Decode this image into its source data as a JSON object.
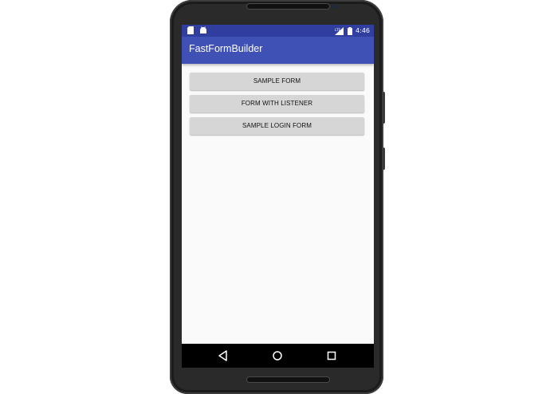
{
  "status_bar": {
    "time": "4:46",
    "network": "LTE",
    "left_icons": [
      "sd-card-icon",
      "android-icon"
    ],
    "right_icons": [
      "signal-icon",
      "battery-icon"
    ],
    "color": "#303f9f"
  },
  "app_bar": {
    "title": "FastFormBuilder",
    "color": "#3f51b5"
  },
  "buttons": [
    {
      "label": "SAMPLE FORM"
    },
    {
      "label": "FORM WITH LISTENER"
    },
    {
      "label": "SAMPLE LOGIN FORM"
    }
  ],
  "nav_bar": {
    "icons": [
      "back-icon",
      "home-icon",
      "recents-icon"
    ]
  }
}
